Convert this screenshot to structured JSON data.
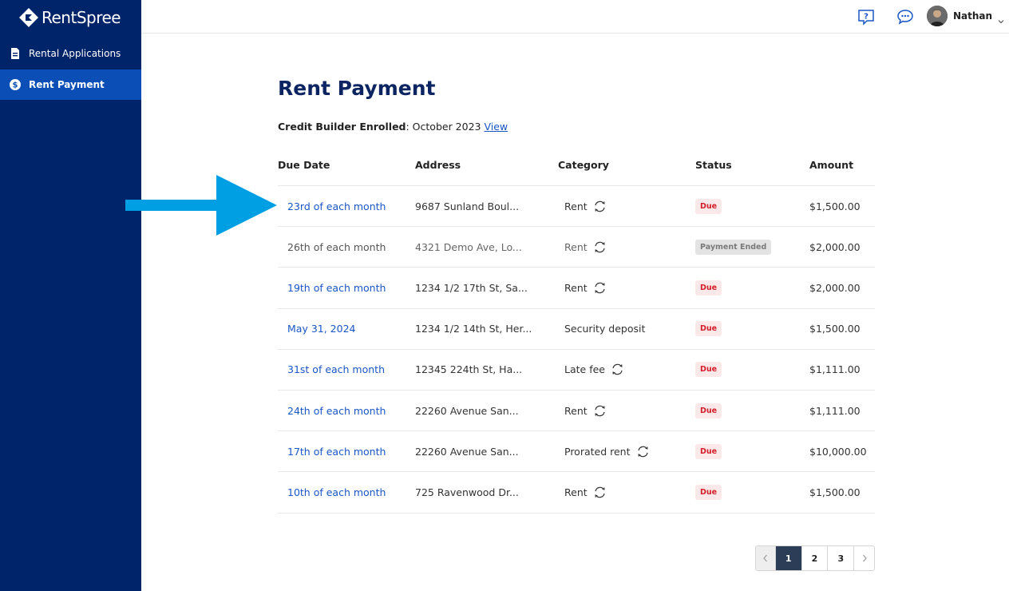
{
  "brand": {
    "name": "RentSpree"
  },
  "sidebar": {
    "items": [
      {
        "label": "Rental Applications",
        "icon": "document-icon",
        "active": false
      },
      {
        "label": "Rent Payment",
        "icon": "dollar-icon",
        "active": true
      }
    ]
  },
  "header": {
    "help_icon": "help-icon",
    "chat_icon": "chat-icon",
    "user_name": "Nathan"
  },
  "main": {
    "title": "Rent Payment",
    "credit_builder": {
      "label": "Credit Builder Enrolled",
      "value": ": October 2023 ",
      "link": "View"
    },
    "table": {
      "columns": [
        "Due Date",
        "Address",
        "Category",
        "Status",
        "Amount"
      ],
      "rows": [
        {
          "due": "23rd of each month",
          "address": "9687 Sunland Boul...",
          "category": "Rent",
          "recurring": true,
          "status": "Due",
          "amount": "$1,500.00"
        },
        {
          "due": "26th of each month",
          "address": "4321 Demo Ave, Lo...",
          "category": "Rent",
          "recurring": true,
          "status": "Payment Ended",
          "amount": "$2,000.00"
        },
        {
          "due": "19th of each month",
          "address": "1234 1/2 17th St, Sa...",
          "category": "Rent",
          "recurring": true,
          "status": "Due",
          "amount": "$2,000.00"
        },
        {
          "due": "May 31, 2024",
          "address": "1234 1/2 14th St, Her...",
          "category": "Security deposit",
          "recurring": false,
          "status": "Due",
          "amount": "$1,500.00"
        },
        {
          "due": "31st of each month",
          "address": "12345 224th St, Ha...",
          "category": "Late fee",
          "recurring": true,
          "status": "Due",
          "amount": "$1,111.00"
        },
        {
          "due": "24th of each month",
          "address": "22260 Avenue San...",
          "category": "Rent",
          "recurring": true,
          "status": "Due",
          "amount": "$1,111.00"
        },
        {
          "due": "17th of each month",
          "address": "22260 Avenue San...",
          "category": "Prorated rent",
          "recurring": true,
          "status": "Due",
          "amount": "$10,000.00"
        },
        {
          "due": "10th of each month",
          "address": "725 Ravenwood Dr...",
          "category": "Rent",
          "recurring": true,
          "status": "Due",
          "amount": "$1,500.00"
        }
      ]
    },
    "pagination": {
      "pages": [
        "1",
        "2",
        "3"
      ],
      "current": "1"
    }
  },
  "colors": {
    "sidebar": "#002469",
    "sidebar_active": "#0b4fb6",
    "title": "#0d2462",
    "link": "#1a56c4",
    "arrow": "#009fe3",
    "due_badge_text": "#d21f2b",
    "due_badge_bg": "#fbe9ea"
  }
}
